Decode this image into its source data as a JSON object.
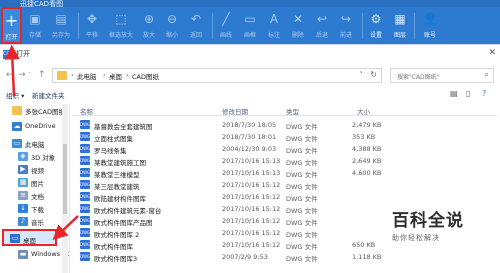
{
  "app": {
    "title": "迅捷CAD看图",
    "toolbar": [
      {
        "label": "打开",
        "icon": "+"
      },
      {
        "label": "存储",
        "icon": "▣"
      },
      {
        "label": "另存为",
        "icon": "▤"
      },
      {
        "label": "平移",
        "icon": "✥"
      },
      {
        "label": "框选放大",
        "icon": "⬚"
      },
      {
        "label": "放大",
        "icon": "⊕"
      },
      {
        "label": "缩小",
        "icon": "⊖"
      },
      {
        "label": "返回",
        "icon": "↶"
      },
      {
        "label": "画线",
        "icon": "╱"
      },
      {
        "label": "画框",
        "icon": "▭"
      },
      {
        "label": "标注",
        "icon": "A"
      },
      {
        "label": "删除",
        "icon": "✕"
      },
      {
        "label": "后退",
        "icon": "↩"
      },
      {
        "label": "前进",
        "icon": "↪"
      },
      {
        "label": "设置",
        "icon": "⚙"
      },
      {
        "label": "图层",
        "icon": "▦"
      },
      {
        "label": "账号",
        "icon": "👤"
      }
    ]
  },
  "dialog": {
    "title": "打开",
    "breadcrumb": [
      "此电脑",
      "桌面",
      "CAD图纸"
    ],
    "search_placeholder": "搜索\"CAD图纸\"",
    "organize": "组织 ▾",
    "new_folder": "新建文件夹",
    "nav": [
      {
        "label": "多张CAD图纸"
      },
      {
        "label": "OneDrive"
      },
      {
        "label": "此电脑"
      },
      {
        "label": "3D 对象"
      },
      {
        "label": "视频"
      },
      {
        "label": "图片"
      },
      {
        "label": "文档"
      },
      {
        "label": "下载"
      },
      {
        "label": "音乐"
      },
      {
        "label": "桌面"
      },
      {
        "label": "Windows (C"
      }
    ],
    "columns": {
      "name": "名称",
      "date": "修改日期",
      "type": "类型",
      "size": "大小"
    },
    "files": [
      {
        "name": "基督教会全套建筑图",
        "date": "2018/7/30 18:05",
        "type": "DWG 文件",
        "size": "2,479 KB"
      },
      {
        "name": "立面柱式图集",
        "date": "2018/7/30 18:01",
        "type": "DWG 文件",
        "size": "353 KB"
      },
      {
        "name": "罗马线条集",
        "date": "2004/12/30 9:03",
        "type": "DWG 文件",
        "size": "4,388 KB"
      },
      {
        "name": "某教堂建筑施工图",
        "date": "2017/10/16 15:13",
        "type": "DWG 文件",
        "size": "2,649 KB"
      },
      {
        "name": "某教堂三维模型",
        "date": "2017/10/16 15:13",
        "type": "DWG 文件",
        "size": "4,600 KB"
      },
      {
        "name": "某三层教堂建筑",
        "date": "2017/10/16 15:12",
        "type": "DWG 文件",
        "size": ""
      },
      {
        "name": "欧陆建材构件图库",
        "date": "2017/10/16 15:12",
        "type": "DWG 文件",
        "size": ""
      },
      {
        "name": "欧式构件建筑元素-窗台",
        "date": "2017/10/16 15:12",
        "type": "DWG 文件",
        "size": ""
      },
      {
        "name": "欧式构件图库产品图",
        "date": "2017/10/16 15:12",
        "type": "DWG 文件",
        "size": ""
      },
      {
        "name": "欧式构件图库 2",
        "date": "2017/10/16 15:12",
        "type": "DWG 文件",
        "size": ""
      },
      {
        "name": "欧式构件图库",
        "date": "2017/10/16 15:12",
        "type": "DWG 文件",
        "size": "650 KB"
      },
      {
        "name": "欧式构件图库3",
        "date": "2007/2/9 9:53",
        "type": "DWG 文件",
        "size": "1,118 KB"
      }
    ]
  },
  "watermark": {
    "big": "百科全说",
    "small": "助你轻松解决"
  }
}
